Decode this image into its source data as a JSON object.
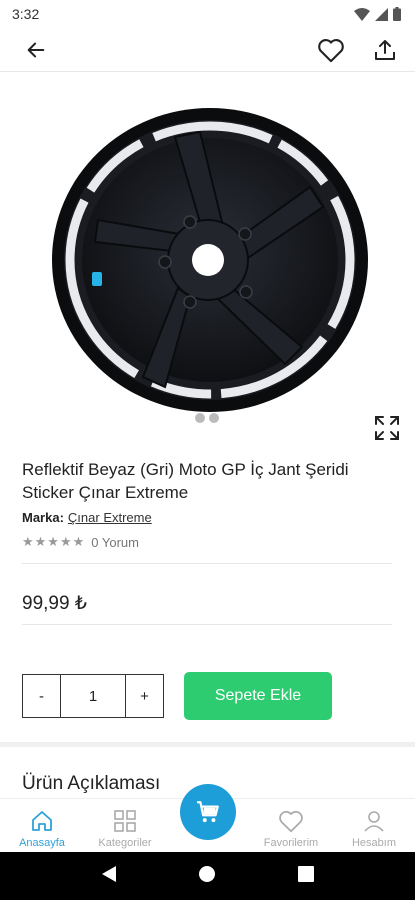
{
  "status_bar": {
    "time": "3:32"
  },
  "product": {
    "title": "Reflektif Beyaz (Gri) Moto GP İç Jant Şeridi Sticker Çınar Extreme",
    "brand_label": "Marka:",
    "brand_name": "Çınar Extreme",
    "stars": "★★★★★",
    "review_count": "0 Yorum",
    "price": "99,99 ₺"
  },
  "quantity": {
    "minus": "-",
    "value": "1",
    "plus": "+"
  },
  "add_to_cart_label": "Sepete Ekle",
  "description_title": "Ürün Açıklaması",
  "bottom_nav": {
    "items": [
      {
        "label": "Anasayfa",
        "icon": "home-icon"
      },
      {
        "label": "Kategoriler",
        "icon": "grid-icon"
      },
      {
        "label": "Favorilerim",
        "icon": "heart-icon"
      },
      {
        "label": "Hesabım",
        "icon": "user-icon"
      }
    ],
    "center_icon": "cart-icon"
  },
  "colors": {
    "accent": "#2ecc71",
    "nav_active": "#2ea2d8",
    "fab": "#1e9ed8"
  }
}
